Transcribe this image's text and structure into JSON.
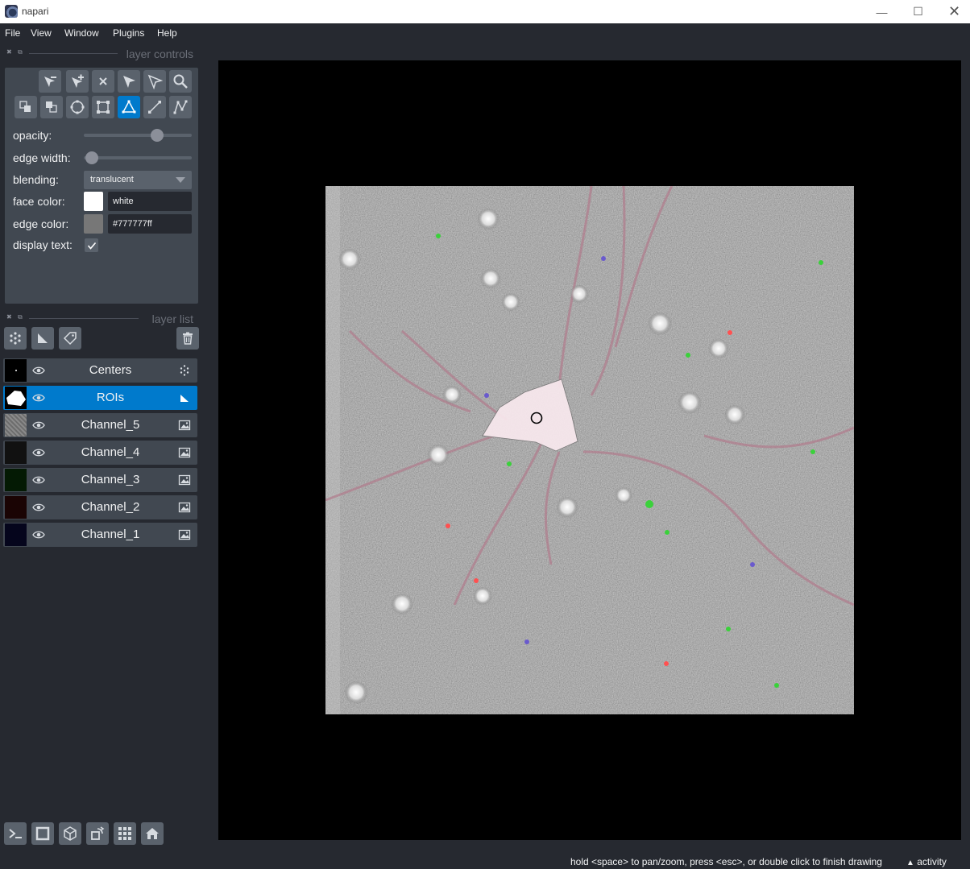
{
  "window": {
    "title": "napari",
    "minimize": "—",
    "maximize": "☐",
    "close": "✕"
  },
  "menu": [
    "File",
    "View",
    "Window",
    "Plugins",
    "Help"
  ],
  "layer_controls": {
    "title": "layer controls",
    "opacity_label": "opacity:",
    "opacity_value": 0.7,
    "edge_width_label": "edge width:",
    "edge_width_value": 0.0,
    "blending_label": "blending:",
    "blending_value": "translucent",
    "face_color_label": "face color:",
    "face_color_value": "white",
    "face_color_hex": "#ffffff",
    "edge_color_label": "edge color:",
    "edge_color_value": "#777777ff",
    "edge_color_hex": "#777777",
    "display_text_label": "display text:",
    "display_text_checked": true,
    "tools": [
      "remove-vertex",
      "add-vertex",
      "delete-shape",
      "select-shape",
      "direct-select",
      "zoom",
      "move-back",
      "move-front",
      "ellipse",
      "rectangle",
      "polygon",
      "line",
      "path"
    ],
    "active_tool": "polygon"
  },
  "layer_list": {
    "title": "layer list",
    "layers": [
      {
        "name": "Centers",
        "type": "points",
        "visible": true,
        "selected": false
      },
      {
        "name": "ROIs",
        "type": "shapes",
        "visible": true,
        "selected": true
      },
      {
        "name": "Channel_5",
        "type": "image",
        "visible": true,
        "selected": false
      },
      {
        "name": "Channel_4",
        "type": "image",
        "visible": true,
        "selected": false
      },
      {
        "name": "Channel_3",
        "type": "image",
        "visible": true,
        "selected": false
      },
      {
        "name": "Channel_2",
        "type": "image",
        "visible": true,
        "selected": false
      },
      {
        "name": "Channel_1",
        "type": "image",
        "visible": true,
        "selected": false
      }
    ]
  },
  "status": {
    "message": "hold <space> to pan/zoom, press <esc>, or double click to finish drawing",
    "activity": "activity"
  },
  "colors": {
    "accent": "#007acc",
    "background": "#262930",
    "panel": "#414851",
    "button": "#5a626c"
  }
}
